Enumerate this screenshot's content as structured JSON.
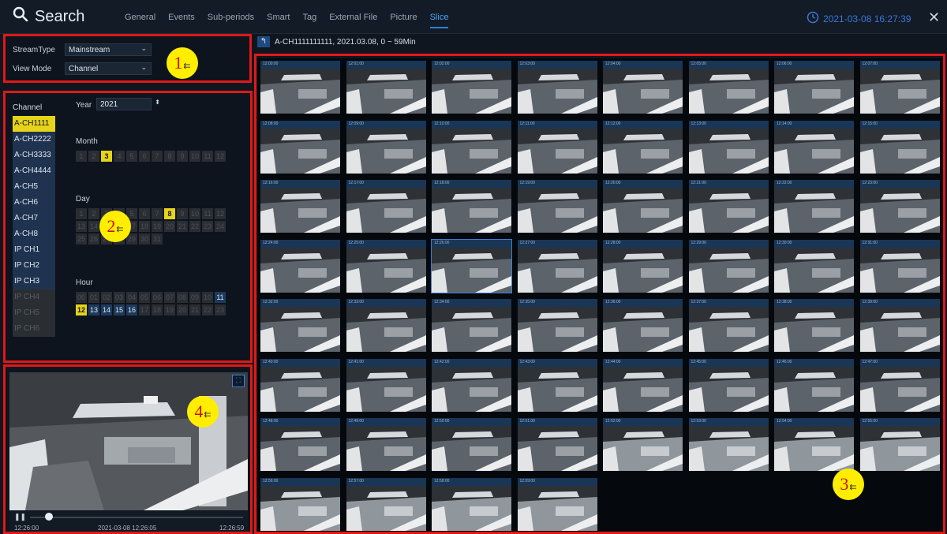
{
  "header": {
    "title": "Search",
    "tabs": [
      {
        "label": "General"
      },
      {
        "label": "Events"
      },
      {
        "label": "Sub-periods"
      },
      {
        "label": "Smart"
      },
      {
        "label": "Tag"
      },
      {
        "label": "External File"
      },
      {
        "label": "Picture"
      },
      {
        "label": "Slice"
      }
    ],
    "active_tab": "Slice",
    "datetime": "2021-03-08 16:27:39",
    "close_label": "✕",
    "accent": "#2f7fd6"
  },
  "stream_panel": {
    "stream_type_label": "StreamType",
    "stream_type_value": "Mainstream",
    "view_mode_label": "View Mode",
    "view_mode_value": "Channel"
  },
  "channels": {
    "title": "Channel",
    "items": [
      {
        "label": "A-CH1111",
        "state": "active"
      },
      {
        "label": "A-CH2222",
        "state": "avail"
      },
      {
        "label": "A-CH3333",
        "state": "avail"
      },
      {
        "label": "A-CH4444",
        "state": "avail"
      },
      {
        "label": "A-CH5",
        "state": "avail"
      },
      {
        "label": "A-CH6",
        "state": "avail"
      },
      {
        "label": "A-CH7",
        "state": "avail"
      },
      {
        "label": "A-CH8",
        "state": "avail"
      },
      {
        "label": "IP CH1",
        "state": "avail"
      },
      {
        "label": "IP CH2",
        "state": "avail"
      },
      {
        "label": "IP CH3",
        "state": "avail"
      },
      {
        "label": "IP CH4",
        "state": "disabled"
      },
      {
        "label": "IP CH5",
        "state": "disabled"
      },
      {
        "label": "IP CH6",
        "state": "disabled"
      }
    ]
  },
  "calendar": {
    "year_label": "Year",
    "year_value": "2021",
    "month_label": "Month",
    "months": [
      "1",
      "2",
      "3",
      "4",
      "5",
      "6",
      "7",
      "8",
      "9",
      "10",
      "11",
      "12"
    ],
    "active_month": "3",
    "day_label": "Day",
    "days": [
      "1",
      "2",
      "3",
      "4",
      "5",
      "6",
      "7",
      "8",
      "9",
      "10",
      "11",
      "12",
      "13",
      "14",
      "15",
      "16",
      "17",
      "18",
      "19",
      "20",
      "21",
      "22",
      "23",
      "24",
      "25",
      "26",
      "27",
      "28",
      "29",
      "30",
      "31"
    ],
    "active_day": "8",
    "hour_label": "Hour",
    "hours": [
      "00",
      "01",
      "02",
      "03",
      "04",
      "05",
      "06",
      "07",
      "08",
      "09",
      "10",
      "11",
      "12",
      "13",
      "14",
      "15",
      "16",
      "17",
      "18",
      "19",
      "20",
      "21",
      "22",
      "23"
    ],
    "available_hours": [
      "11",
      "13",
      "14",
      "15",
      "16"
    ],
    "active_hour": "12"
  },
  "slice_path": "A-CH1111111111,  2021.03.08,  0 ~ 59Min",
  "slices": {
    "timestamps": [
      "12:00:00",
      "12:01:00",
      "12:02:00",
      "12:03:00",
      "12:04:00",
      "12:05:00",
      "12:06:00",
      "12:07:00",
      "12:08:00",
      "12:09:00",
      "12:10:00",
      "12:11:00",
      "12:12:00",
      "12:13:00",
      "12:14:00",
      "12:15:00",
      "12:16:00",
      "12:17:00",
      "12:18:00",
      "12:19:00",
      "12:20:00",
      "12:21:00",
      "12:22:00",
      "12:23:00",
      "12:24:00",
      "12:25:00",
      "12:26:00",
      "12:27:00",
      "12:28:00",
      "12:29:00",
      "12:30:00",
      "12:31:00",
      "12:32:00",
      "12:33:00",
      "12:34:00",
      "12:35:00",
      "12:36:00",
      "12:37:00",
      "12:38:00",
      "12:39:00",
      "12:40:00",
      "12:41:00",
      "12:42:00",
      "12:43:00",
      "12:44:00",
      "12:45:00",
      "12:46:00",
      "12:47:00",
      "12:48:00",
      "12:49:00",
      "12:50:00",
      "12:51:00",
      "12:52:00",
      "12:53:00",
      "12:54:00",
      "12:55:00",
      "12:56:00",
      "12:57:00",
      "12:58:00",
      "12:59:00"
    ],
    "selected": "12:26:00"
  },
  "playback": {
    "start_time": "12:26:00",
    "current_datetime": "2021-03-08 12:26:05",
    "end_time": "12:26:59",
    "progress_fraction": 0.09
  },
  "callouts": [
    "1",
    "2",
    "3",
    "4"
  ]
}
